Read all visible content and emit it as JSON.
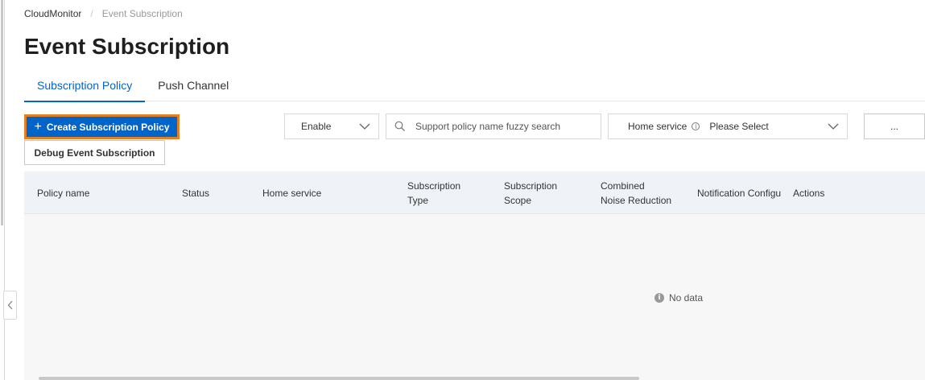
{
  "breadcrumb": {
    "root": "CloudMonitor",
    "separator": "/",
    "current": "Event Subscription"
  },
  "page": {
    "title": "Event Subscription"
  },
  "tabs": [
    {
      "label": "Subscription Policy",
      "active": true
    },
    {
      "label": "Push Channel",
      "active": false
    }
  ],
  "toolbar": {
    "create_label": "Create Subscription Policy",
    "debug_label": "Debug Event Subscription",
    "status_select": "Enable",
    "search_placeholder": "Support policy name fuzzy search",
    "home_service_label": "Home service",
    "home_service_value": "Please Select",
    "more_label": "..."
  },
  "table": {
    "columns": [
      {
        "lines": [
          "Policy name"
        ]
      },
      {
        "lines": [
          "Status"
        ]
      },
      {
        "lines": [
          "Home service"
        ]
      },
      {
        "lines": [
          "Subscription",
          "Type"
        ]
      },
      {
        "lines": [
          "Subscription",
          "Scope"
        ]
      },
      {
        "lines": [
          "Combined",
          "Noise Reduction"
        ]
      },
      {
        "lines": [
          "Notification Configu"
        ]
      },
      {
        "lines": [
          "Actions"
        ]
      }
    ],
    "empty_text": "No data"
  },
  "colors": {
    "primary": "#0064c8",
    "highlight_border": "#e67e22",
    "header_bg": "#eff3f8"
  },
  "icons": [
    "plus-icon",
    "search-icon",
    "chevron-down-icon",
    "info-icon",
    "chevron-left-icon"
  ]
}
